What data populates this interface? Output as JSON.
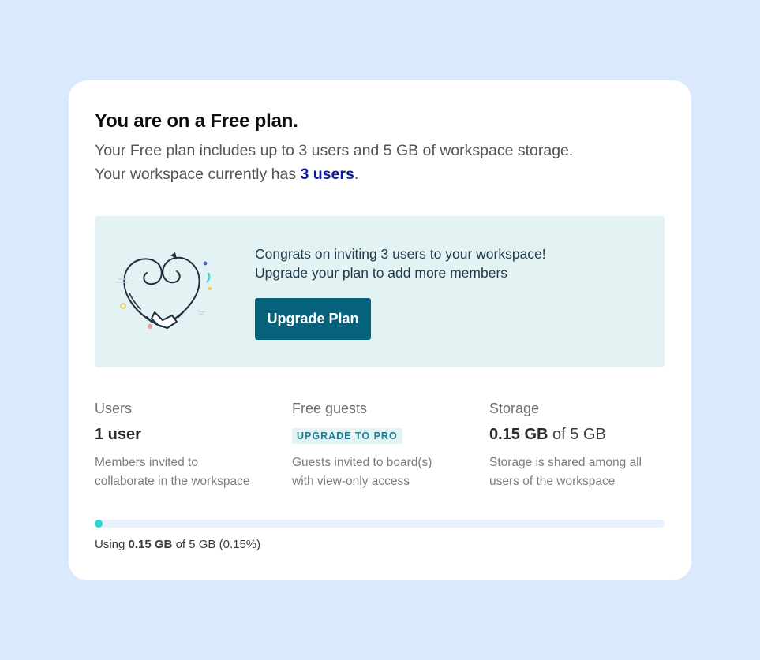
{
  "plan": {
    "title": "You are on a Free plan.",
    "description_line1": "Your Free plan includes up to 3 users and 5 GB of workspace storage.",
    "description_line2_prefix": "Your workspace currently has ",
    "description_line2_highlight": "3 users",
    "description_line2_suffix": "."
  },
  "banner": {
    "illustration_icon": "heart-handshake-icon",
    "message_line1": "Congrats on inviting 3 users to your workspace!",
    "message_line2": "Upgrade your plan to add more members",
    "button_label": "Upgrade Plan",
    "background_color": "#e3f2f2",
    "button_color": "#05617c"
  },
  "stats": {
    "users": {
      "label": "Users",
      "value": "1 user",
      "note_line1": "Members invited to",
      "note_line2": "collaborate in the workspace"
    },
    "guests": {
      "label": "Free guests",
      "badge": "UPGRADE TO PRO",
      "note_line1": "Guests invited to board(s)",
      "note_line2": "with view-only access"
    },
    "storage": {
      "label": "Storage",
      "value_bold": "0.15 GB",
      "value_rest": " of 5 GB",
      "note_line1": "Storage is shared among all",
      "note_line2": "users of the workspace"
    }
  },
  "usage": {
    "prefix": "Using ",
    "used": "0.15 GB",
    "suffix": " of 5 GB (0.15%)",
    "percent": 0.15,
    "fill_color": "#2dd5d5"
  }
}
